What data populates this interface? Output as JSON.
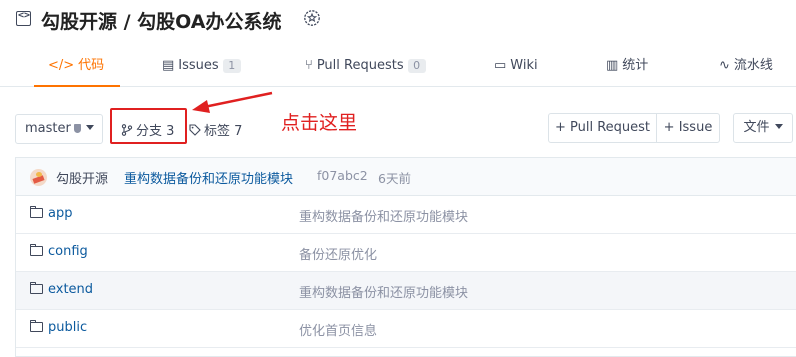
{
  "repo": {
    "title": "勾股开源 / 勾股OA办公系统"
  },
  "tabs": [
    {
      "icon": "code-icon",
      "label": "代码",
      "active": true
    },
    {
      "icon": "issues-icon",
      "label": "Issues",
      "count": "1"
    },
    {
      "icon": "pull-request-icon",
      "label": "Pull Requests",
      "count": "0"
    },
    {
      "icon": "wiki-icon",
      "label": "Wiki"
    },
    {
      "icon": "stats-icon",
      "label": "统计"
    },
    {
      "icon": "pipeline-icon",
      "label": "流水线"
    }
  ],
  "toolbar": {
    "branch": "master",
    "branches_label": "分支 3",
    "tags_label": "标签 7",
    "pull_request_button": "+ Pull Request",
    "issue_button": "+ Issue",
    "files_button": "文件"
  },
  "annotation": {
    "text": "点击这里",
    "color": "#e02020"
  },
  "commit": {
    "author": "勾股开源",
    "message": "重构数据备份和还原功能模块",
    "sha": "f07abc2",
    "time": "6天前"
  },
  "files": [
    {
      "name": "app",
      "message": "重构数据备份和还原功能模块"
    },
    {
      "name": "config",
      "message": "备份还原优化"
    },
    {
      "name": "extend",
      "message": "重构数据备份和还原功能模块"
    },
    {
      "name": "public",
      "message": "优化首页信息"
    }
  ],
  "colors": {
    "accent": "#fe7300",
    "link": "#0c5a9e"
  }
}
